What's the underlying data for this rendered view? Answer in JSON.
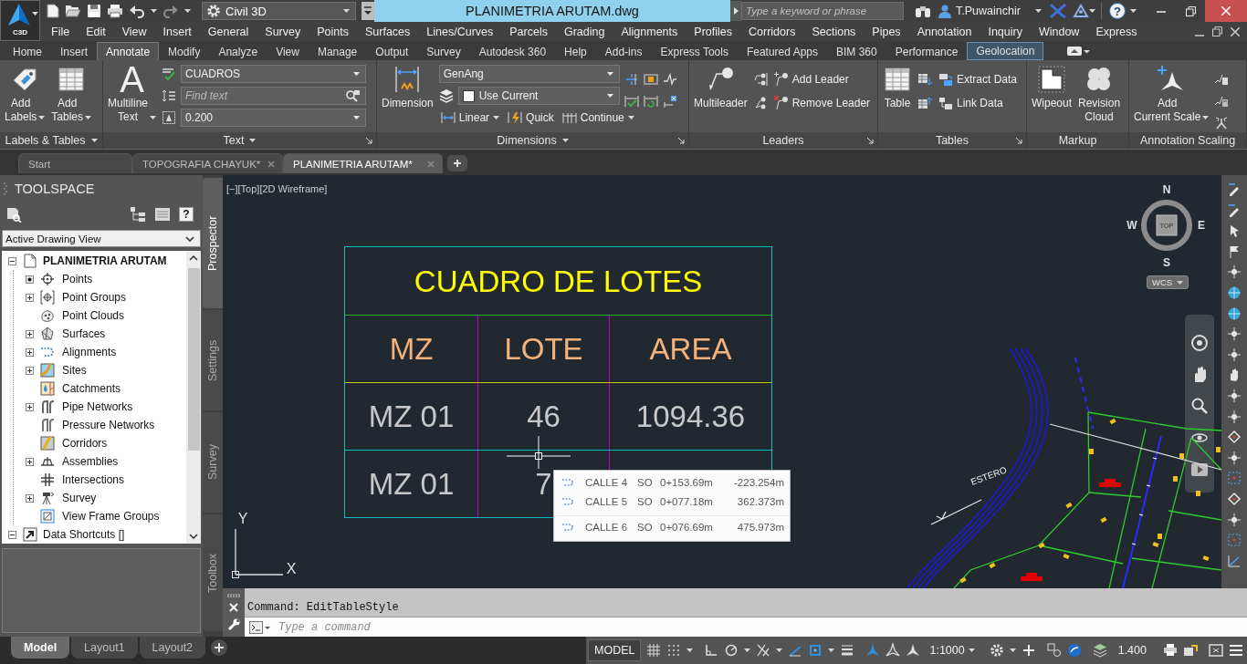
{
  "app_button": {
    "label": "C3D"
  },
  "quick_access": {
    "workspace": "Civil 3D"
  },
  "window": {
    "title": "PLANIMETRIA ARUTAM.dwg"
  },
  "help_search": {
    "placeholder": "Type a keyword or phrase"
  },
  "user": {
    "name": "T.Puwainchir"
  },
  "help_button": {
    "glyph": "?"
  },
  "menu_bar": [
    "File",
    "Edit",
    "View",
    "Insert",
    "General",
    "Survey",
    "Points",
    "Surfaces",
    "Lines/Curves",
    "Parcels",
    "Grading",
    "Alignments",
    "Profiles",
    "Corridors",
    "Sections",
    "Pipes",
    "Annotation",
    "Inquiry",
    "Window",
    "Express"
  ],
  "ribbon_tabs": [
    {
      "label": "Home",
      "selected": false,
      "highlighted": false
    },
    {
      "label": "Insert",
      "selected": false,
      "highlighted": false
    },
    {
      "label": "Annotate",
      "selected": true,
      "highlighted": false
    },
    {
      "label": "Modify",
      "selected": false,
      "highlighted": false
    },
    {
      "label": "Analyze",
      "selected": false,
      "highlighted": false
    },
    {
      "label": "View",
      "selected": false,
      "highlighted": false
    },
    {
      "label": "Manage",
      "selected": false,
      "highlighted": false
    },
    {
      "label": "Output",
      "selected": false,
      "highlighted": false
    },
    {
      "label": "Survey",
      "selected": false,
      "highlighted": false
    },
    {
      "label": "Autodesk 360",
      "selected": false,
      "highlighted": false
    },
    {
      "label": "Help",
      "selected": false,
      "highlighted": false
    },
    {
      "label": "Add-ins",
      "selected": false,
      "highlighted": false
    },
    {
      "label": "Express Tools",
      "selected": false,
      "highlighted": false
    },
    {
      "label": "Featured Apps",
      "selected": false,
      "highlighted": false
    },
    {
      "label": "BIM 360",
      "selected": false,
      "highlighted": false
    },
    {
      "label": "Performance",
      "selected": false,
      "highlighted": false
    },
    {
      "label": "Geolocation",
      "selected": false,
      "highlighted": true
    }
  ],
  "ribbon_panels": [
    {
      "title": "Labels & Tables",
      "menu": true,
      "columns": [
        [
          [
            {
              "kind": "large",
              "label": "Add Labels",
              "caret": true
            }
          ]
        ],
        [
          [
            {
              "kind": "large",
              "label": "Add Tables",
              "caret": true
            }
          ]
        ]
      ]
    },
    {
      "title": "Text",
      "menu": true,
      "launcher": true,
      "columns": [
        [
          [
            {
              "kind": "large",
              "label": "Multiline Text",
              "caret": true,
              "glyph": "A"
            }
          ]
        ],
        [
          [
            {
              "kind": "icon"
            },
            {
              "kind": "combo",
              "value": "CUADROS"
            }
          ],
          [
            {
              "kind": "icon"
            },
            {
              "kind": "search",
              "placeholder": "Find text"
            }
          ],
          [
            {
              "kind": "icon"
            },
            {
              "kind": "combo",
              "value": "0.200"
            }
          ]
        ]
      ]
    },
    {
      "title": "Dimensions",
      "menu": true,
      "launcher": true,
      "columns": [
        [
          [
            {
              "kind": "large",
              "label": "Dimension"
            }
          ]
        ],
        [
          [
            {
              "kind": "combo",
              "value": "GenAng"
            }
          ],
          [
            {
              "kind": "icon"
            },
            {
              "kind": "combo",
              "value": "Use Current",
              "color": "#ffffff"
            }
          ],
          [
            {
              "kind": "small",
              "label": "Linear",
              "caret": true
            },
            {
              "kind": "small",
              "label": "Quick"
            },
            {
              "kind": "small",
              "label": "Continue",
              "caret": true
            }
          ]
        ],
        [
          [
            {
              "kind": "icon"
            },
            {
              "kind": "icon"
            },
            {
              "kind": "icon"
            }
          ],
          [
            {
              "kind": "icon"
            },
            {
              "kind": "icon"
            },
            {
              "kind": "icon"
            }
          ]
        ]
      ]
    },
    {
      "title": "Leaders",
      "launcher": true,
      "columns": [
        [
          [
            {
              "kind": "large",
              "label": "Multileader"
            }
          ]
        ],
        [
          [
            {
              "kind": "icon"
            },
            {
              "kind": "small",
              "label": "Add Leader"
            }
          ],
          [
            {
              "kind": "icon"
            },
            {
              "kind": "small",
              "label": "Remove Leader"
            }
          ]
        ]
      ]
    },
    {
      "title": "Tables",
      "launcher": true,
      "columns": [
        [
          [
            {
              "kind": "large",
              "label": "Table"
            }
          ]
        ],
        [
          [
            {
              "kind": "icon"
            },
            {
              "kind": "small",
              "label": "Extract Data"
            }
          ],
          [
            {
              "kind": "icon"
            },
            {
              "kind": "small",
              "label": "Link Data"
            }
          ]
        ]
      ]
    },
    {
      "title": "Markup",
      "columns": [
        [
          [
            {
              "kind": "large",
              "label": "Wipeout"
            }
          ]
        ],
        [
          [
            {
              "kind": "large",
              "label": "Revision Cloud"
            }
          ]
        ]
      ]
    },
    {
      "title": "Annotation Scaling",
      "columns": [
        [
          [
            {
              "kind": "large",
              "label": "Add Current Scale",
              "caret": true
            }
          ]
        ],
        [
          [
            {
              "kind": "icon"
            }
          ],
          [
            {
              "kind": "icon"
            }
          ],
          [
            {
              "kind": "icon"
            }
          ]
        ]
      ]
    }
  ],
  "file_tabs": [
    {
      "label": "Start",
      "selected": false,
      "closable": false
    },
    {
      "label": "TOPOGRAFIA CHAYUK*",
      "selected": false,
      "closable": true
    },
    {
      "label": "PLANIMETRIA ARUTAM*",
      "selected": true,
      "closable": true
    }
  ],
  "toolspace": {
    "title": "TOOLSPACE",
    "help_glyph": "?",
    "view": "Active Drawing View",
    "tree": [
      {
        "label": "PLANIMETRIA ARUTAM",
        "current": true,
        "expanded": true,
        "children": [
          {
            "label": "Points",
            "dot": true
          },
          {
            "label": "Point Groups",
            "expanded": false
          },
          {
            "label": "Point Clouds"
          },
          {
            "label": "Surfaces",
            "expanded": false
          },
          {
            "label": "Alignments",
            "expanded": false
          },
          {
            "label": "Sites",
            "expanded": false
          },
          {
            "label": "Catchments"
          },
          {
            "label": "Pipe Networks",
            "expanded": false
          },
          {
            "label": "Pressure Networks"
          },
          {
            "label": "Corridors"
          },
          {
            "label": "Assemblies",
            "expanded": false
          },
          {
            "label": "Intersections"
          },
          {
            "label": "Survey",
            "expanded": false
          },
          {
            "label": "View Frame Groups"
          }
        ]
      },
      {
        "label": "Data Shortcuts []",
        "current": false,
        "expanded": true
      }
    ],
    "side_tabs": [
      {
        "label": "Prospector",
        "selected": true
      },
      {
        "label": "Settings",
        "selected": false
      },
      {
        "label": "Survey",
        "selected": false
      },
      {
        "label": "Toolbox",
        "selected": false
      }
    ]
  },
  "viewport": {
    "view_label": "[−][Top][2D Wireframe]",
    "table": {
      "title": "CUADRO DE LOTES",
      "columns": [
        "MZ",
        "LOTE",
        "AREA"
      ],
      "rows": [
        [
          "MZ 01",
          "46",
          "1094.36"
        ],
        [
          "MZ 01",
          "7"
        ]
      ]
    },
    "station_tooltip": [
      {
        "name": "CALLE 4",
        "side": "SO",
        "station": "0+153.69m",
        "offset": "-223.254m"
      },
      {
        "name": "CALLE 5",
        "side": "SO",
        "station": "0+077.18m",
        "offset": "362.373m"
      },
      {
        "name": "CALLE 6",
        "side": "SO",
        "station": "0+076.69m",
        "offset": "475.973m"
      }
    ],
    "compass": {
      "north": "N",
      "south": "S",
      "east": "E",
      "west": "W",
      "cube": "TOP",
      "ucs_menu": "WCS"
    },
    "ucs_icon": {
      "x": "X",
      "y": "Y"
    },
    "drawing_labels": [
      "ESTERO"
    ]
  },
  "command_line": {
    "history": "Command: EditTableStyle",
    "placeholder": "Type a command"
  },
  "layout_tabs": [
    {
      "label": "Model",
      "selected": true
    },
    {
      "label": "Layout1",
      "selected": false
    },
    {
      "label": "Layout2",
      "selected": false
    }
  ],
  "status_bar": {
    "space": "MODEL",
    "annotation_scale": "1:1000",
    "value": "1.400"
  }
}
